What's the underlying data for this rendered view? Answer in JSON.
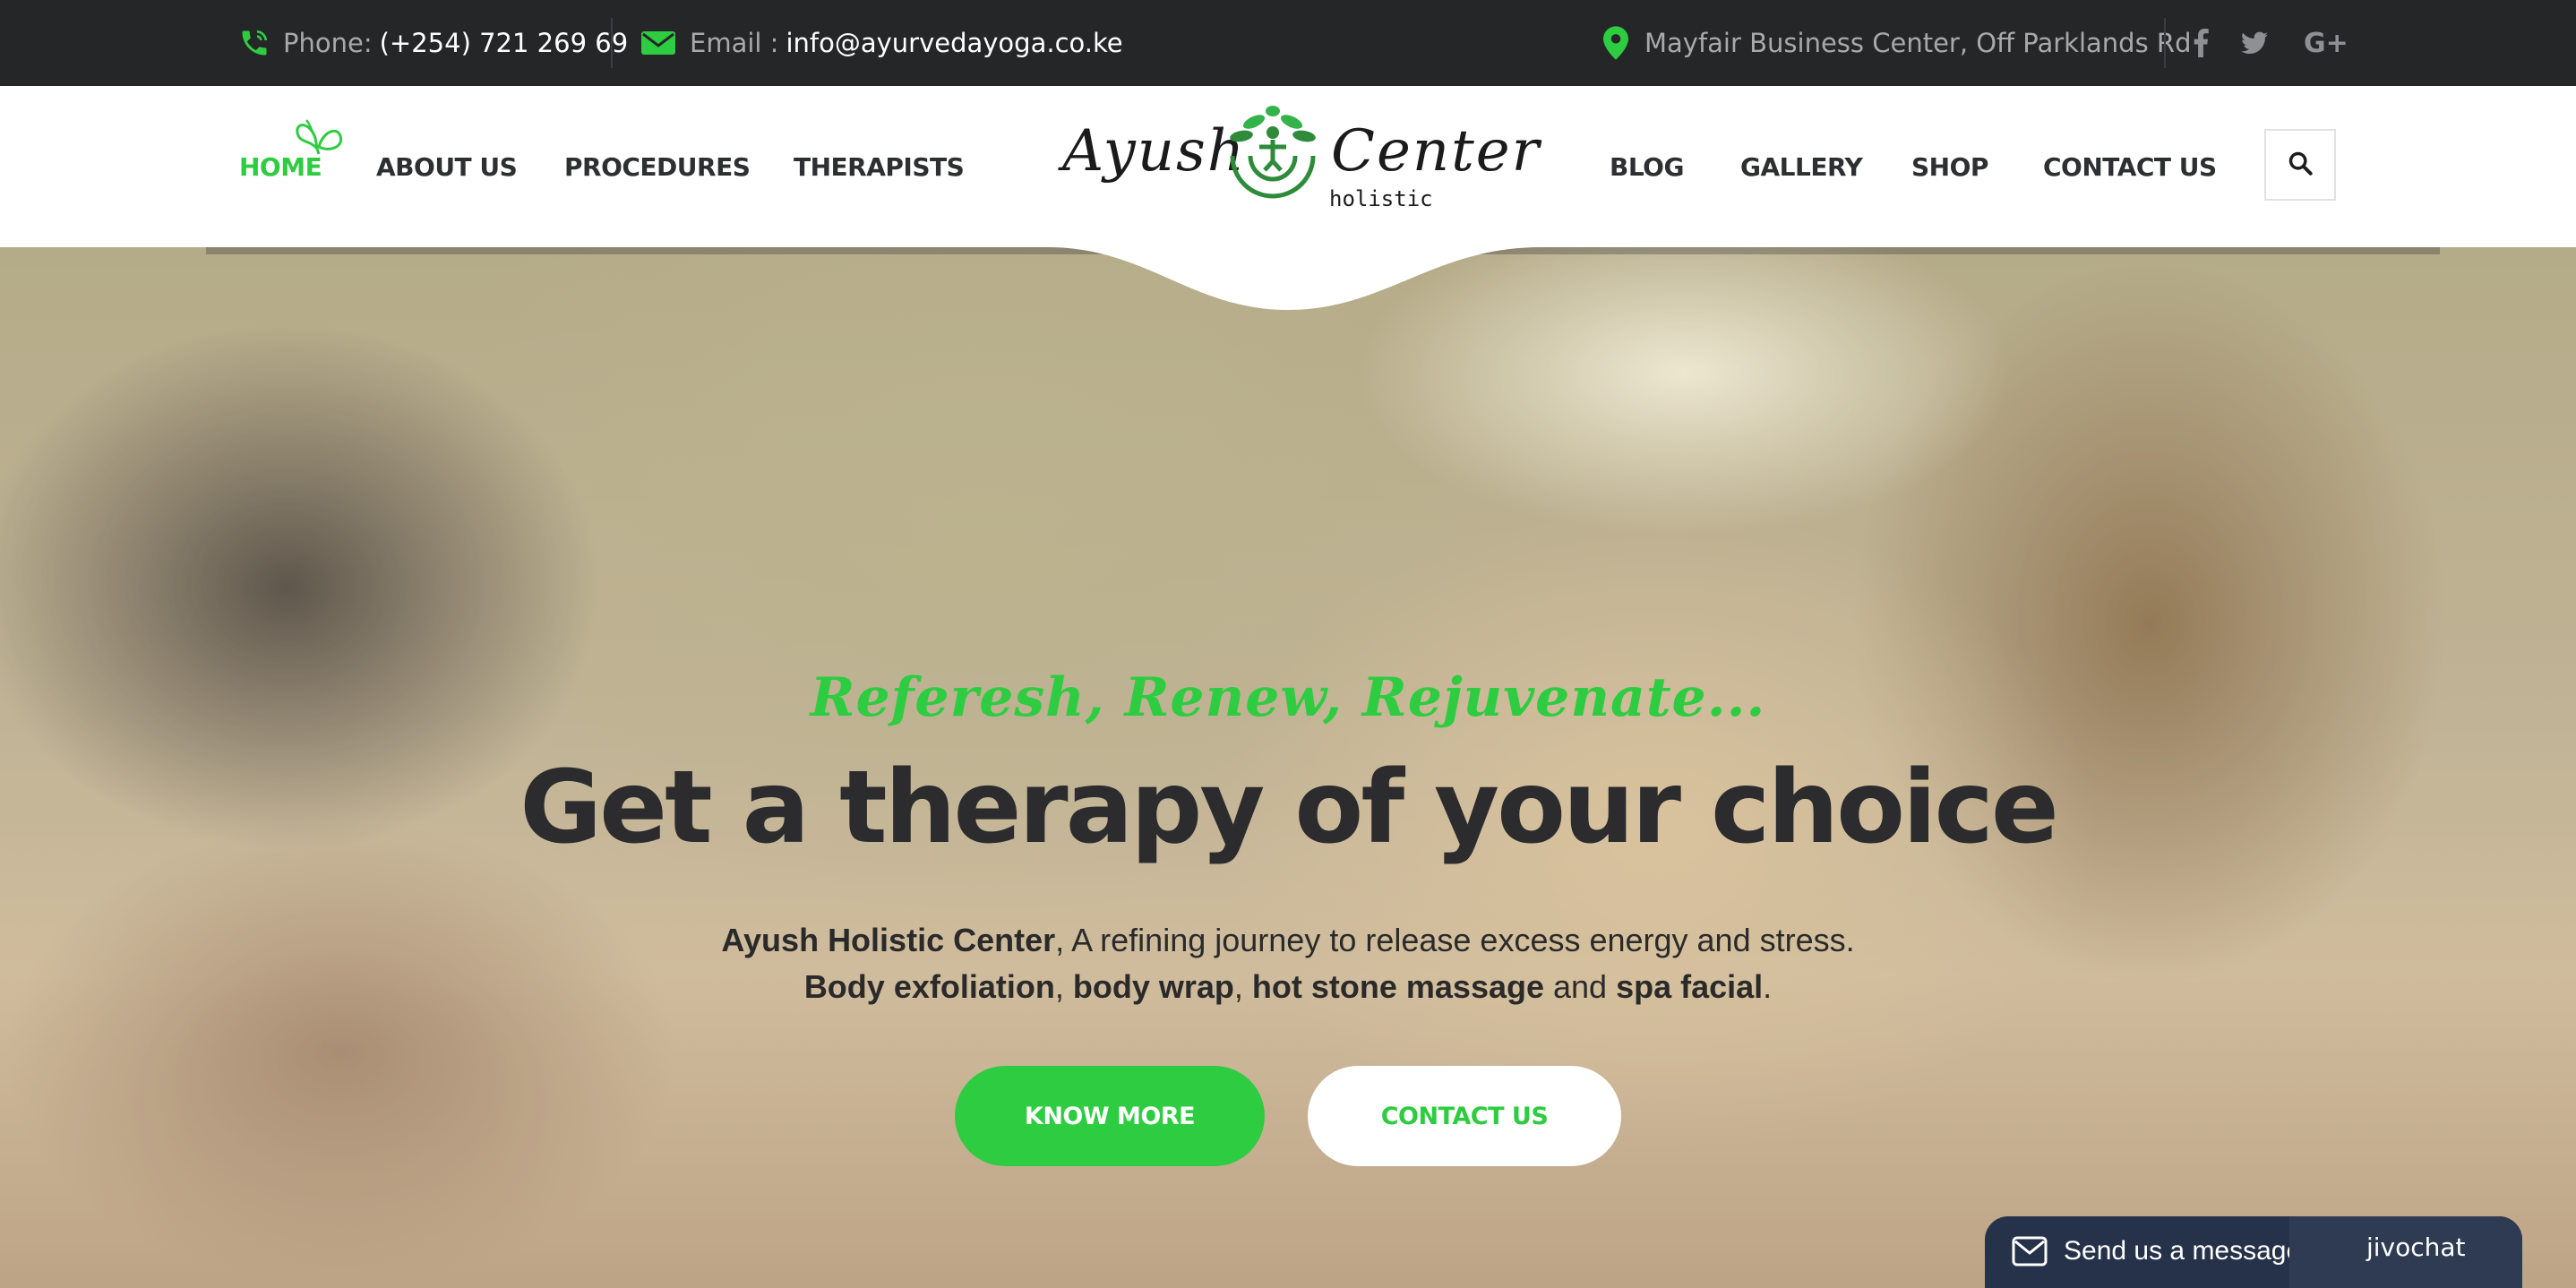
{
  "topbar": {
    "phone_label": "Phone:",
    "phone_value": "(+254) 721 269 69",
    "email_label": "Email :",
    "email_value": "info@ayurvedayoga.co.ke",
    "address": "Mayfair Business Center, Off Parklands Rd",
    "social": [
      "f",
      "twitter",
      "G+"
    ]
  },
  "nav": {
    "left": [
      "HOME",
      "ABOUT US",
      "PROCEDURES",
      "THERAPISTS"
    ],
    "right": [
      "BLOG",
      "GALLERY",
      "SHOP",
      "CONTACT US"
    ],
    "active": "HOME"
  },
  "logo": {
    "word1": "Ayush",
    "word2": "Center",
    "small": "holistic"
  },
  "hero": {
    "tagline": "Referesh, Renew, Rejuvenate...",
    "headline": "Get a therapy of your choice",
    "line1": {
      "b1": "Ayush Holistic Center",
      "t1": ", A refining journey to release excess energy and stress."
    },
    "line2": {
      "b1": "Body exfoliation",
      "t1": ", ",
      "b2": "body wrap",
      "t2": ", ",
      "b3": "hot stone massage",
      "t3": " and ",
      "b4": "spa facial",
      "t4": "."
    },
    "btn_primary": "KNOW MORE",
    "btn_secondary": "CONTACT US"
  },
  "chat": {
    "label": "Send us a message",
    "brand": "jivochat"
  },
  "colors": {
    "accent": "#2ecc40",
    "topbar_bg": "#252628",
    "heading": "#2c2c2e",
    "chat_bg": "#263249"
  },
  "icons": [
    "phone-icon",
    "envelope-icon",
    "map-pin-icon",
    "facebook-icon",
    "twitter-icon",
    "google-plus-icon",
    "search-icon",
    "butterfly-icon",
    "lotus-logo-icon",
    "chat-envelope-icon"
  ]
}
